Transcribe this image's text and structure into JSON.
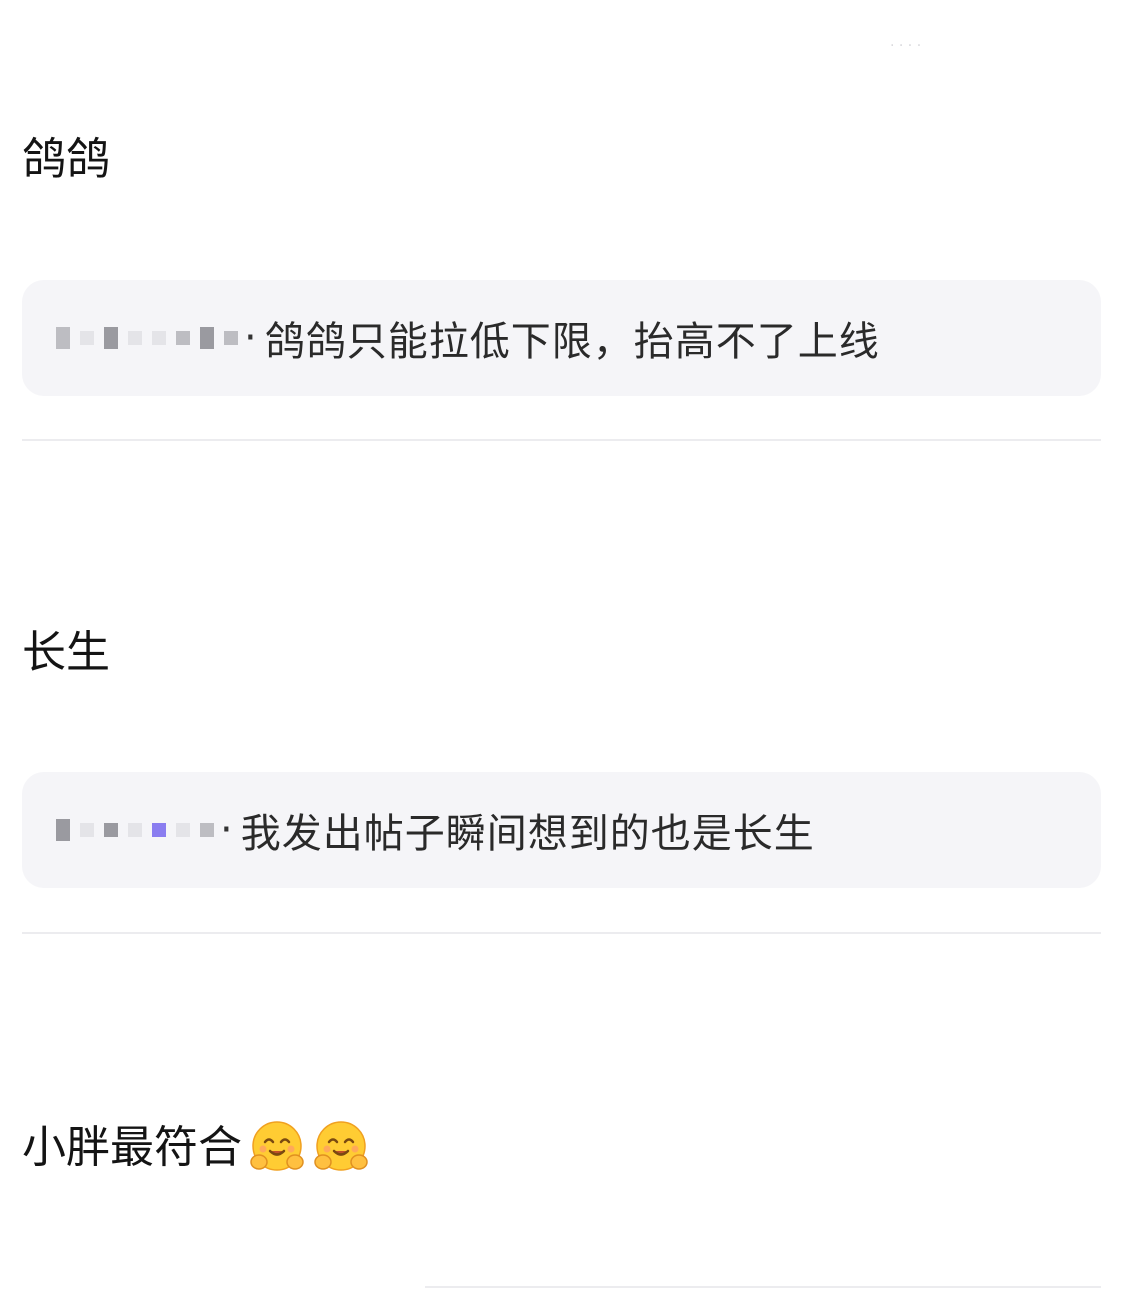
{
  "comments": [
    {
      "text": "鸽鸽",
      "reply": {
        "separator": "·",
        "text": "鸽鸽只能拉低下限，抬高不了上线"
      }
    },
    {
      "text": "长生",
      "reply": {
        "separator": "·",
        "text": "我发出帖子瞬间想到的也是长生"
      }
    },
    {
      "text": "小胖最符合",
      "emojis": [
        "hug-smile-emoji",
        "hug-smile-emoji"
      ]
    }
  ],
  "colors": {
    "reply_background": "#f5f5f8",
    "divider": "#ececef",
    "text": "#141414",
    "emoji_face": "#ffcc33"
  }
}
